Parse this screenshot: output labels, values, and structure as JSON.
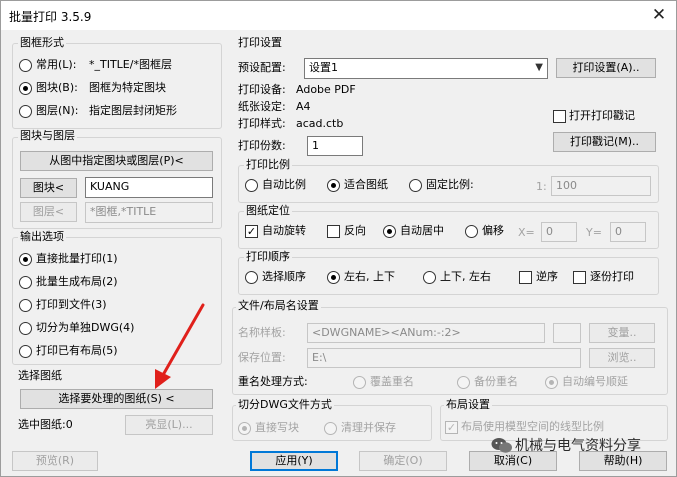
{
  "title": "批量打印 3.5.9",
  "frame_style": {
    "heading": "图框形式",
    "options": [
      {
        "label": "常用(L):",
        "value": "*_TITLE/*图框层",
        "selected": false
      },
      {
        "label": "图块(B):",
        "value": "图框为特定图块",
        "selected": true
      },
      {
        "label": "图层(N):",
        "value": "指定图层封闭矩形",
        "selected": false
      }
    ]
  },
  "block_layer": {
    "heading": "图块与图层",
    "pick_button": "从图中指定图块或图层(P)<",
    "block_button": "图块<",
    "block_value": "KUANG",
    "layer_button": "图层<",
    "layer_value": "*图框,*TITLE"
  },
  "output": {
    "heading": "输出选项",
    "options": [
      {
        "label": "直接批量打印(1)",
        "selected": true
      },
      {
        "label": "批量生成布局(2)",
        "selected": false
      },
      {
        "label": "打印到文件(3)",
        "selected": false
      },
      {
        "label": "切分为单独DWG(4)",
        "selected": false
      },
      {
        "label": "打印已有布局(5)",
        "selected": false
      }
    ]
  },
  "select": {
    "heading": "选择图纸",
    "select_button": "选择要处理的图纸(S) <",
    "count_label": "选中图纸:0",
    "highlight_button": "亮显(L)..."
  },
  "print_settings": {
    "heading": "打印设置",
    "preset_label": "预设配置:",
    "preset_value": "设置1",
    "settings_button": "打印设置(A)..",
    "device_label": "打印设备:",
    "device_value": "Adobe PDF",
    "paper_label": "纸张设定:",
    "paper_value": "A4",
    "style_label": "打印样式:",
    "style_value": "acad.ctb",
    "stamp_check_label": "打开打印戳记",
    "stamp_button": "打印戳记(M)..",
    "copies_label": "打印份数:",
    "copies_value": "1"
  },
  "scale": {
    "heading": "打印比例",
    "options": [
      {
        "label": "自动比例",
        "selected": false
      },
      {
        "label": "适合图纸",
        "selected": true
      },
      {
        "label": "固定比例:",
        "selected": false
      }
    ],
    "ratio_left": "1:",
    "ratio_value": "100"
  },
  "position": {
    "heading": "图纸定位",
    "auto_rotate": "自动旋转",
    "auto_rotate_checked": true,
    "reverse": "反向",
    "center": "自动居中",
    "offset": "偏移",
    "x_label": "X=",
    "x_value": "0",
    "y_label": "Y=",
    "y_value": "0"
  },
  "order": {
    "heading": "打印顺序",
    "options": [
      {
        "label": "选择顺序",
        "selected": false
      },
      {
        "label": "左右, 上下",
        "selected": true
      },
      {
        "label": "上下, 左右",
        "selected": false
      }
    ],
    "reverse_label": "逆序",
    "page_by_page_label": "逐份打印"
  },
  "file_naming": {
    "heading": "文件/布局名设置",
    "name_sample_label": "名称样板:",
    "name_sample_value": "<DWGNAME><ANum:-:2>",
    "change_button": "变量..",
    "save_location_label": "保存位置:",
    "save_location_value": "E:\\",
    "browse_button": "浏览..",
    "rename_label": "重名处理方式:",
    "rename_options": [
      {
        "label": "覆盖重名",
        "selected": false
      },
      {
        "label": "备份重名",
        "selected": false
      },
      {
        "label": "自动编号顺延",
        "selected": true
      }
    ]
  },
  "split_dwg": {
    "heading": "切分DWG文件方式",
    "options": [
      {
        "label": "直接写块",
        "selected": true
      },
      {
        "label": "清理并保存",
        "selected": false
      }
    ]
  },
  "layout_settings": {
    "heading": "布局设置",
    "check_label": "布局使用模型空间的线型比例",
    "checked": true
  },
  "bottom": {
    "preview": "预览(R)",
    "apply": "应用(Y)",
    "ok": "确定(O)",
    "cancel": "取消(C)",
    "help": "帮助(H)"
  },
  "watermark": "机械与电气资料分享",
  "accent_color": "#0078d7",
  "arrow_color": "#e0201b"
}
